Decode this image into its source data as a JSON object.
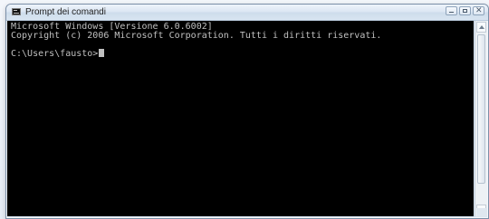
{
  "window": {
    "title": "Prompt dei comandi"
  },
  "console": {
    "lines": [
      "Microsoft Windows [Versione 6.0.6002]",
      "Copyright (c) 2006 Microsoft Corporation. Tutti i diritti riservati."
    ],
    "prompt": "C:\\Users\\fausto>"
  },
  "controls": {
    "minimize": "minimize-icon",
    "maximize": "maximize-icon",
    "close": "close-icon",
    "close_symbol": "✕"
  }
}
